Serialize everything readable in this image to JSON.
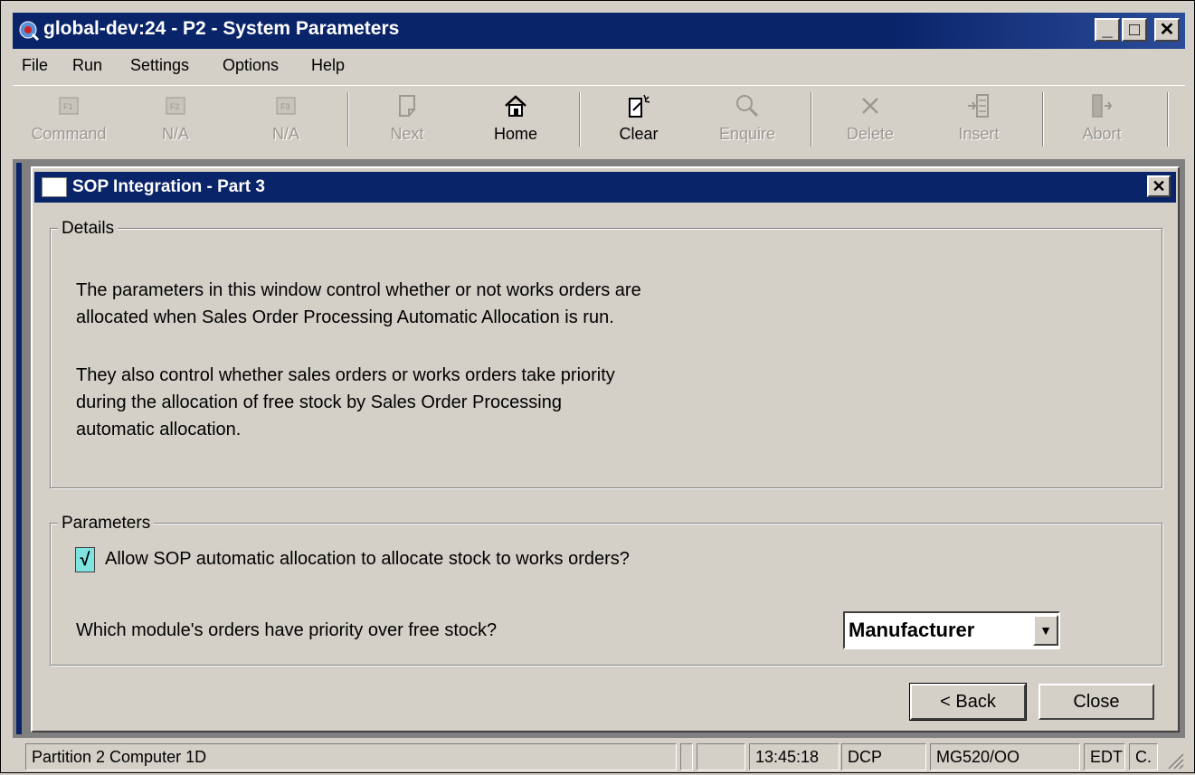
{
  "window": {
    "title": "global-dev:24 - P2 - System Parameters",
    "min": "_",
    "max": "□",
    "close": "✕"
  },
  "menu": {
    "items": [
      "File",
      "Run",
      "Settings",
      "Options",
      "Help"
    ]
  },
  "toolbar": {
    "buttons": [
      {
        "label": "Command",
        "icon": "f1-key-icon",
        "enabled": false
      },
      {
        "label": "N/A",
        "icon": "f2-key-icon",
        "enabled": false
      },
      {
        "label": "N/A",
        "icon": "f3-key-icon",
        "enabled": false
      },
      {
        "label": "Next",
        "icon": "next-page-icon",
        "enabled": false
      },
      {
        "label": "Home",
        "icon": "home-icon",
        "enabled": true
      },
      {
        "label": "Clear",
        "icon": "clear-icon",
        "enabled": true
      },
      {
        "label": "Enquire",
        "icon": "magnifier-icon",
        "enabled": false
      },
      {
        "label": "Delete",
        "icon": "delete-x-icon",
        "enabled": false
      },
      {
        "label": "Insert",
        "icon": "insert-icon",
        "enabled": false
      },
      {
        "label": "Abort",
        "icon": "abort-door-icon",
        "enabled": false
      }
    ]
  },
  "child": {
    "title": "SOP Integration - Part 3",
    "close": "✕"
  },
  "details": {
    "legend": "Details",
    "para1": [
      "The parameters in this window control whether or not works orders are",
      "allocated when Sales Order Processing Automatic Allocation is run."
    ],
    "para2": [
      "They also control whether sales orders or works orders take priority",
      "during the allocation of free stock by Sales Order Processing",
      "automatic allocation."
    ]
  },
  "parameters": {
    "legend": "Parameters",
    "checkbox": {
      "mark": "√",
      "label": "Allow SOP automatic allocation to allocate stock to works orders?",
      "checked": true
    },
    "priority_label": "Which module's orders have priority over free stock?",
    "priority_value": "Manufacturer",
    "priority_arrow": "▼"
  },
  "buttons": {
    "back": "< Back",
    "close": "Close"
  },
  "statusbar": {
    "partition": "Partition 2 Computer 1D",
    "time": "13:45:18",
    "company": "DCP",
    "program": "MG520/OO",
    "mode": "EDT",
    "extra": "C."
  },
  "colors": {
    "title_bg": "#0a246a",
    "face": "#d4d0c8",
    "checkbox_bg": "#7fe3e0"
  }
}
